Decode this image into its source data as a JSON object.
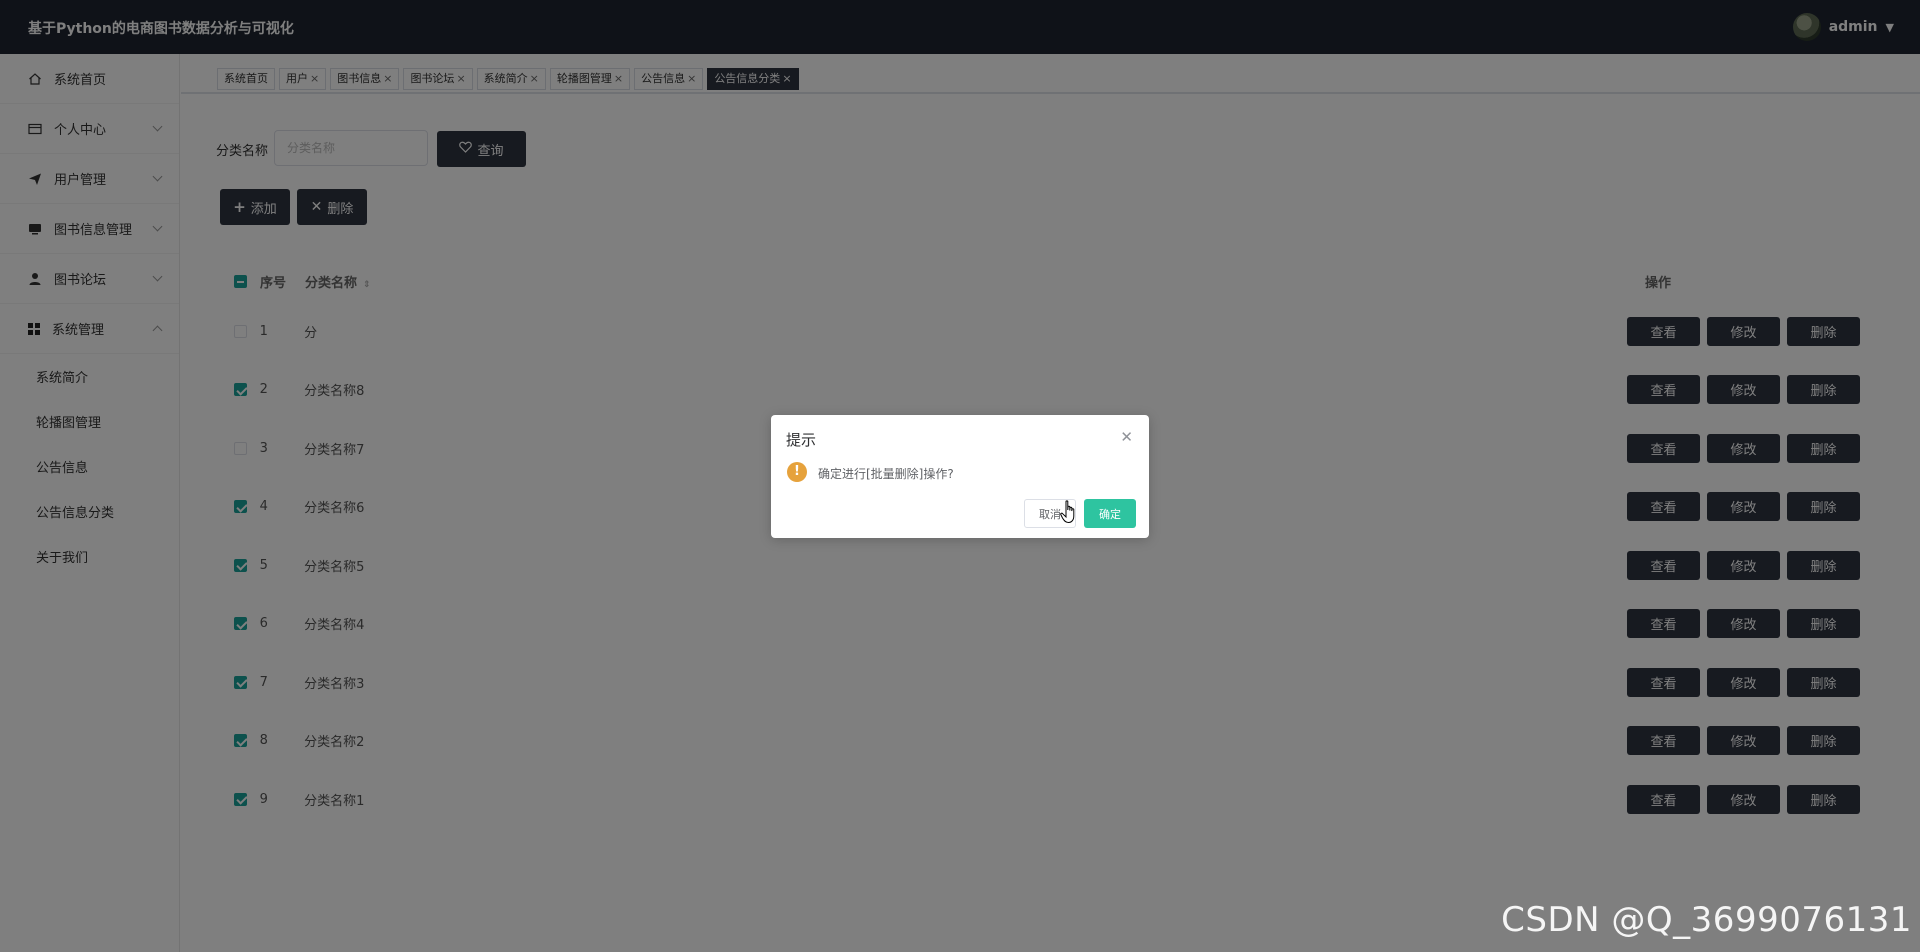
{
  "header": {
    "app_title": "基于Python的电商图书数据分析与可视化",
    "username": "admin"
  },
  "sidebar": {
    "items": [
      {
        "label": "系统首页",
        "icon": "home-icon"
      },
      {
        "label": "个人中心",
        "icon": "card-icon"
      },
      {
        "label": "用户管理",
        "icon": "send-icon"
      },
      {
        "label": "图书信息管理",
        "icon": "monitor-icon"
      },
      {
        "label": "图书论坛",
        "icon": "user-icon"
      },
      {
        "label": "系统管理",
        "icon": "grid-icon"
      }
    ],
    "submenu": [
      "系统简介",
      "轮播图管理",
      "公告信息",
      "公告信息分类",
      "关于我们"
    ]
  },
  "tabs": [
    {
      "label": "系统首页",
      "closable": false
    },
    {
      "label": "用户",
      "closable": true
    },
    {
      "label": "图书信息",
      "closable": true
    },
    {
      "label": "图书论坛",
      "closable": true
    },
    {
      "label": "系统简介",
      "closable": true
    },
    {
      "label": "轮播图管理",
      "closable": true
    },
    {
      "label": "公告信息",
      "closable": true
    },
    {
      "label": "公告信息分类",
      "closable": true,
      "active": true
    }
  ],
  "search": {
    "label": "分类名称",
    "placeholder": "分类名称",
    "query_label": "查询"
  },
  "actions": {
    "add_label": "添加",
    "delete_label": "删除"
  },
  "table": {
    "headers": {
      "index": "序号",
      "name": "分类名称",
      "ops": "操作"
    },
    "ops": {
      "view": "查看",
      "edit": "修改",
      "delete": "删除"
    },
    "rows": [
      {
        "index": "1",
        "name": "分",
        "checked": false
      },
      {
        "index": "2",
        "name": "分类名称8",
        "checked": true
      },
      {
        "index": "3",
        "name": "分类名称7",
        "checked": false
      },
      {
        "index": "4",
        "name": "分类名称6",
        "checked": true
      },
      {
        "index": "5",
        "name": "分类名称5",
        "checked": true
      },
      {
        "index": "6",
        "name": "分类名称4",
        "checked": true
      },
      {
        "index": "7",
        "name": "分类名称3",
        "checked": true
      },
      {
        "index": "8",
        "name": "分类名称2",
        "checked": true
      },
      {
        "index": "9",
        "name": "分类名称1",
        "checked": true
      }
    ]
  },
  "dialog": {
    "title": "提示",
    "message": "确定进行[批量删除]操作?",
    "cancel_label": "取消",
    "ok_label": "确定"
  },
  "watermark": "CSDN @Q_3699076131",
  "colors": {
    "header_bg": "#1e2530",
    "button_dark": "#2e3440",
    "checkbox": "#1aa39a",
    "confirm": "#2ec4a0",
    "warning": "#e6a23c"
  }
}
